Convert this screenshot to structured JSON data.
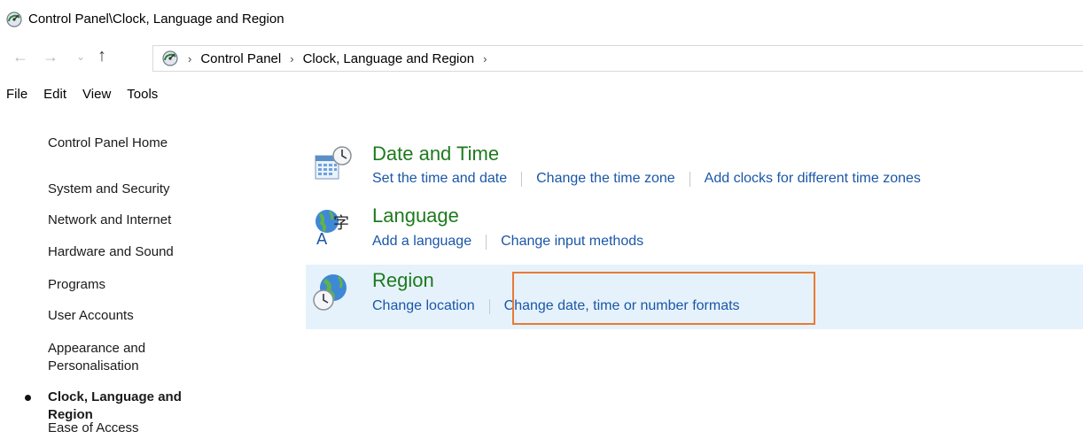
{
  "window": {
    "title": "Control Panel\\Clock, Language and Region"
  },
  "navigation": {
    "back_glyph": "←",
    "forward_glyph": "→",
    "recent_glyph": "⌄",
    "up_glyph": "↑",
    "breadcrumb_separator": "›",
    "breadcrumbs": [
      "Control Panel",
      "Clock, Language and Region"
    ]
  },
  "menu": {
    "items": [
      "File",
      "Edit",
      "View",
      "Tools"
    ]
  },
  "sidebar": {
    "home": "Control Panel Home",
    "items": [
      "System and Security",
      "Network and Internet",
      "Hardware and Sound",
      "Programs",
      "User Accounts",
      "Appearance and Personalisation",
      "Clock, Language and Region",
      "Ease of Access"
    ],
    "active_index": 6
  },
  "categories": [
    {
      "title": "Date and Time",
      "icon": "calendar-clock-icon",
      "links": [
        "Set the time and date",
        "Change the time zone",
        "Add clocks for different time zones"
      ]
    },
    {
      "title": "Language",
      "icon": "globe-language-icon",
      "links": [
        "Add a language",
        "Change input methods"
      ]
    },
    {
      "title": "Region",
      "icon": "globe-clock-icon",
      "links": [
        "Change location",
        "Change date, time or number formats"
      ],
      "highlighted": true
    }
  ],
  "colors": {
    "link": "#1a56a8",
    "category_title": "#1e7a1e",
    "highlight_background": "#e6f2fb",
    "annotation_border": "#e87b35"
  }
}
